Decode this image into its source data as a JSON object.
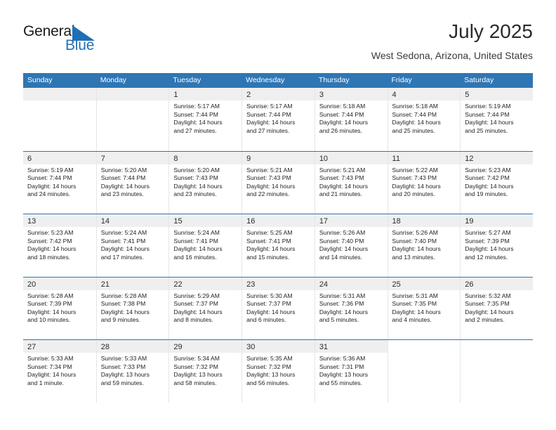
{
  "brand": {
    "name_part1": "General",
    "name_part2": "Blue",
    "mark": "triangle-logo"
  },
  "header": {
    "title": "July 2025",
    "location": "West Sedona, Arizona, United States"
  },
  "colors": {
    "header_blue": "#2f76b5",
    "brand_blue": "#2272b5",
    "daynum_strip": "#efefef",
    "cell_border": "#e6e6e6"
  },
  "day_headers": [
    "Sunday",
    "Monday",
    "Tuesday",
    "Wednesday",
    "Thursday",
    "Friday",
    "Saturday"
  ],
  "weeks": [
    [
      {
        "day": "",
        "sunrise": "",
        "sunset": "",
        "daylight_line1": "",
        "daylight_line2": "",
        "empty": true
      },
      {
        "day": "",
        "sunrise": "",
        "sunset": "",
        "daylight_line1": "",
        "daylight_line2": "",
        "empty": true
      },
      {
        "day": "1",
        "sunrise": "Sunrise: 5:17 AM",
        "sunset": "Sunset: 7:44 PM",
        "daylight_line1": "Daylight: 14 hours",
        "daylight_line2": "and 27 minutes."
      },
      {
        "day": "2",
        "sunrise": "Sunrise: 5:17 AM",
        "sunset": "Sunset: 7:44 PM",
        "daylight_line1": "Daylight: 14 hours",
        "daylight_line2": "and 27 minutes."
      },
      {
        "day": "3",
        "sunrise": "Sunrise: 5:18 AM",
        "sunset": "Sunset: 7:44 PM",
        "daylight_line1": "Daylight: 14 hours",
        "daylight_line2": "and 26 minutes."
      },
      {
        "day": "4",
        "sunrise": "Sunrise: 5:18 AM",
        "sunset": "Sunset: 7:44 PM",
        "daylight_line1": "Daylight: 14 hours",
        "daylight_line2": "and 25 minutes."
      },
      {
        "day": "5",
        "sunrise": "Sunrise: 5:19 AM",
        "sunset": "Sunset: 7:44 PM",
        "daylight_line1": "Daylight: 14 hours",
        "daylight_line2": "and 25 minutes."
      }
    ],
    [
      {
        "day": "6",
        "sunrise": "Sunrise: 5:19 AM",
        "sunset": "Sunset: 7:44 PM",
        "daylight_line1": "Daylight: 14 hours",
        "daylight_line2": "and 24 minutes."
      },
      {
        "day": "7",
        "sunrise": "Sunrise: 5:20 AM",
        "sunset": "Sunset: 7:44 PM",
        "daylight_line1": "Daylight: 14 hours",
        "daylight_line2": "and 23 minutes."
      },
      {
        "day": "8",
        "sunrise": "Sunrise: 5:20 AM",
        "sunset": "Sunset: 7:43 PM",
        "daylight_line1": "Daylight: 14 hours",
        "daylight_line2": "and 23 minutes."
      },
      {
        "day": "9",
        "sunrise": "Sunrise: 5:21 AM",
        "sunset": "Sunset: 7:43 PM",
        "daylight_line1": "Daylight: 14 hours",
        "daylight_line2": "and 22 minutes."
      },
      {
        "day": "10",
        "sunrise": "Sunrise: 5:21 AM",
        "sunset": "Sunset: 7:43 PM",
        "daylight_line1": "Daylight: 14 hours",
        "daylight_line2": "and 21 minutes."
      },
      {
        "day": "11",
        "sunrise": "Sunrise: 5:22 AM",
        "sunset": "Sunset: 7:43 PM",
        "daylight_line1": "Daylight: 14 hours",
        "daylight_line2": "and 20 minutes."
      },
      {
        "day": "12",
        "sunrise": "Sunrise: 5:23 AM",
        "sunset": "Sunset: 7:42 PM",
        "daylight_line1": "Daylight: 14 hours",
        "daylight_line2": "and 19 minutes."
      }
    ],
    [
      {
        "day": "13",
        "sunrise": "Sunrise: 5:23 AM",
        "sunset": "Sunset: 7:42 PM",
        "daylight_line1": "Daylight: 14 hours",
        "daylight_line2": "and 18 minutes."
      },
      {
        "day": "14",
        "sunrise": "Sunrise: 5:24 AM",
        "sunset": "Sunset: 7:41 PM",
        "daylight_line1": "Daylight: 14 hours",
        "daylight_line2": "and 17 minutes."
      },
      {
        "day": "15",
        "sunrise": "Sunrise: 5:24 AM",
        "sunset": "Sunset: 7:41 PM",
        "daylight_line1": "Daylight: 14 hours",
        "daylight_line2": "and 16 minutes."
      },
      {
        "day": "16",
        "sunrise": "Sunrise: 5:25 AM",
        "sunset": "Sunset: 7:41 PM",
        "daylight_line1": "Daylight: 14 hours",
        "daylight_line2": "and 15 minutes."
      },
      {
        "day": "17",
        "sunrise": "Sunrise: 5:26 AM",
        "sunset": "Sunset: 7:40 PM",
        "daylight_line1": "Daylight: 14 hours",
        "daylight_line2": "and 14 minutes."
      },
      {
        "day": "18",
        "sunrise": "Sunrise: 5:26 AM",
        "sunset": "Sunset: 7:40 PM",
        "daylight_line1": "Daylight: 14 hours",
        "daylight_line2": "and 13 minutes."
      },
      {
        "day": "19",
        "sunrise": "Sunrise: 5:27 AM",
        "sunset": "Sunset: 7:39 PM",
        "daylight_line1": "Daylight: 14 hours",
        "daylight_line2": "and 12 minutes."
      }
    ],
    [
      {
        "day": "20",
        "sunrise": "Sunrise: 5:28 AM",
        "sunset": "Sunset: 7:39 PM",
        "daylight_line1": "Daylight: 14 hours",
        "daylight_line2": "and 10 minutes."
      },
      {
        "day": "21",
        "sunrise": "Sunrise: 5:28 AM",
        "sunset": "Sunset: 7:38 PM",
        "daylight_line1": "Daylight: 14 hours",
        "daylight_line2": "and 9 minutes."
      },
      {
        "day": "22",
        "sunrise": "Sunrise: 5:29 AM",
        "sunset": "Sunset: 7:37 PM",
        "daylight_line1": "Daylight: 14 hours",
        "daylight_line2": "and 8 minutes."
      },
      {
        "day": "23",
        "sunrise": "Sunrise: 5:30 AM",
        "sunset": "Sunset: 7:37 PM",
        "daylight_line1": "Daylight: 14 hours",
        "daylight_line2": "and 6 minutes."
      },
      {
        "day": "24",
        "sunrise": "Sunrise: 5:31 AM",
        "sunset": "Sunset: 7:36 PM",
        "daylight_line1": "Daylight: 14 hours",
        "daylight_line2": "and 5 minutes."
      },
      {
        "day": "25",
        "sunrise": "Sunrise: 5:31 AM",
        "sunset": "Sunset: 7:35 PM",
        "daylight_line1": "Daylight: 14 hours",
        "daylight_line2": "and 4 minutes."
      },
      {
        "day": "26",
        "sunrise": "Sunrise: 5:32 AM",
        "sunset": "Sunset: 7:35 PM",
        "daylight_line1": "Daylight: 14 hours",
        "daylight_line2": "and 2 minutes."
      }
    ],
    [
      {
        "day": "27",
        "sunrise": "Sunrise: 5:33 AM",
        "sunset": "Sunset: 7:34 PM",
        "daylight_line1": "Daylight: 14 hours",
        "daylight_line2": "and 1 minute."
      },
      {
        "day": "28",
        "sunrise": "Sunrise: 5:33 AM",
        "sunset": "Sunset: 7:33 PM",
        "daylight_line1": "Daylight: 13 hours",
        "daylight_line2": "and 59 minutes."
      },
      {
        "day": "29",
        "sunrise": "Sunrise: 5:34 AM",
        "sunset": "Sunset: 7:32 PM",
        "daylight_line1": "Daylight: 13 hours",
        "daylight_line2": "and 58 minutes."
      },
      {
        "day": "30",
        "sunrise": "Sunrise: 5:35 AM",
        "sunset": "Sunset: 7:32 PM",
        "daylight_line1": "Daylight: 13 hours",
        "daylight_line2": "and 56 minutes."
      },
      {
        "day": "31",
        "sunrise": "Sunrise: 5:36 AM",
        "sunset": "Sunset: 7:31 PM",
        "daylight_line1": "Daylight: 13 hours",
        "daylight_line2": "and 55 minutes."
      },
      {
        "day": "",
        "sunrise": "",
        "sunset": "",
        "daylight_line1": "",
        "daylight_line2": "",
        "empty": true,
        "blank": true
      },
      {
        "day": "",
        "sunrise": "",
        "sunset": "",
        "daylight_line1": "",
        "daylight_line2": "",
        "empty": true,
        "blank": true
      }
    ]
  ]
}
